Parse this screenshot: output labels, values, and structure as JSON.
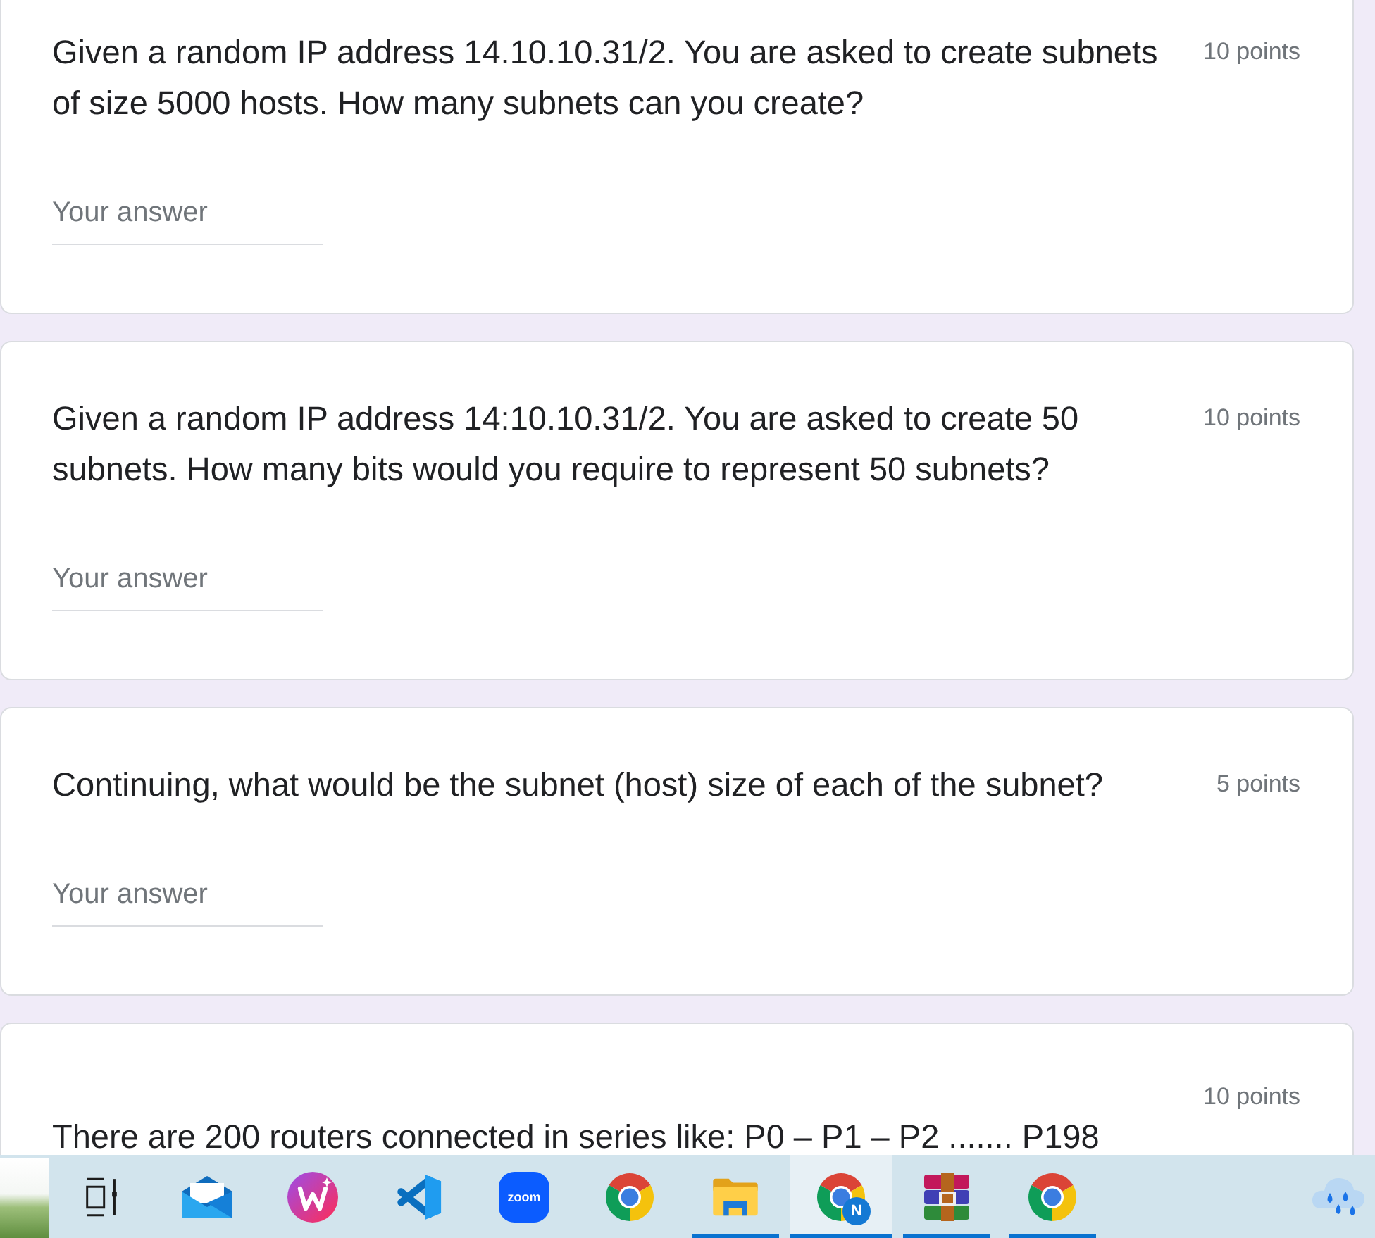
{
  "form": {
    "questions": [
      {
        "kind": "short_answer",
        "text": "Given a random IP address 14.10.10.31/2. You are asked to create subnets of size 5000 hosts. How many subnets can you create?",
        "points": "10 points",
        "answer": {
          "placeholder": "Your answer"
        }
      },
      {
        "kind": "short_answer",
        "text": "Given a random IP address 14:10.10.31/2. You are asked to create 50 subnets. How many bits would you require to represent 50 subnets?",
        "points": "10 points",
        "answer": {
          "placeholder": "Your answer"
        }
      },
      {
        "kind": "short_answer",
        "text": "Continuing, what would be the subnet (host) size of each of the subnet?",
        "points": "5 points",
        "answer": {
          "placeholder": "Your answer"
        }
      },
      {
        "kind": "long_question",
        "text": "There are 200 routers connected in series like: P0 – P1 – P2 ....... P198",
        "points": "10 points"
      }
    ]
  },
  "taskbar": {
    "widget": {
      "kind": "photo"
    },
    "items": [
      {
        "kind": "task_view",
        "running": false,
        "selected": false
      },
      {
        "kind": "mail",
        "running": false,
        "selected": false
      },
      {
        "kind": "office",
        "running": false,
        "selected": false
      },
      {
        "kind": "editor",
        "running": false,
        "selected": false
      },
      {
        "kind": "meeting",
        "label": "zoom",
        "running": false,
        "selected": false
      },
      {
        "kind": "browser",
        "running": false,
        "selected": false
      },
      {
        "kind": "folder",
        "running": true,
        "selected": false
      },
      {
        "kind": "browser",
        "badge": "N",
        "running": true,
        "selected": true
      },
      {
        "kind": "archive",
        "running": true,
        "selected": false
      },
      {
        "kind": "browser",
        "running": true,
        "selected": false
      }
    ],
    "tray": {
      "weather": {
        "kind": "rain"
      }
    }
  }
}
